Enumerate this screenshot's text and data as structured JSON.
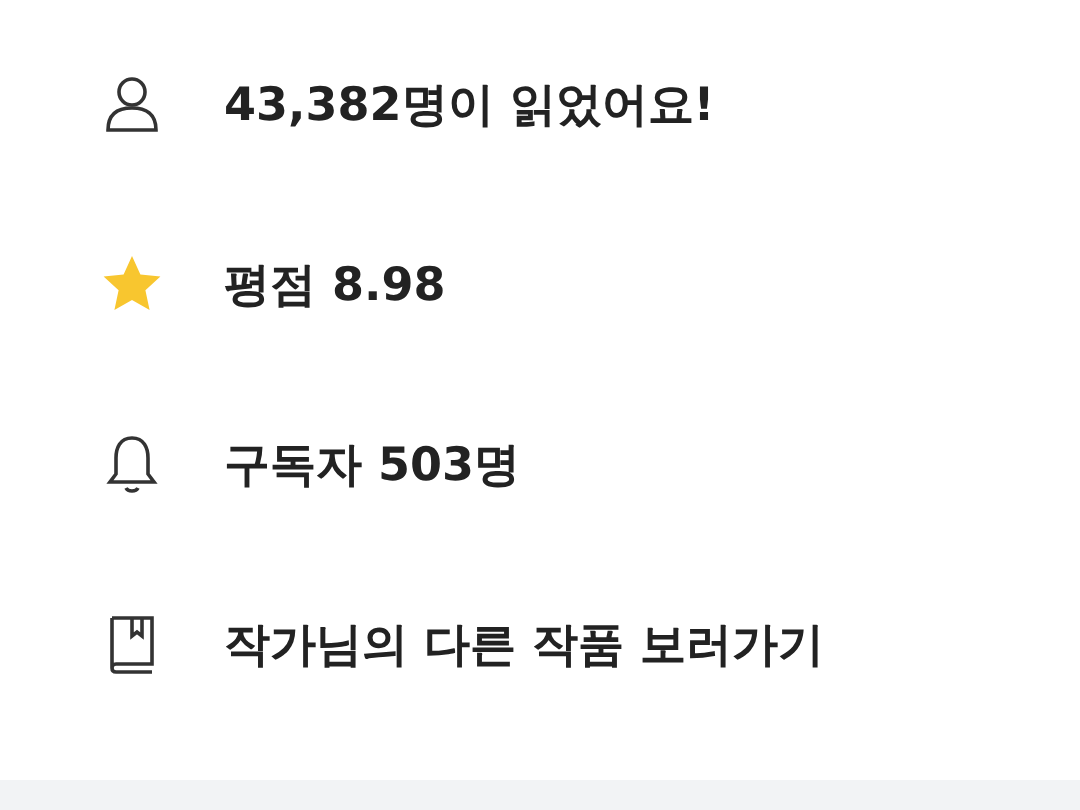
{
  "info_rows": [
    {
      "kind": "readers",
      "text": "43,382명이 읽었어요!"
    },
    {
      "kind": "rating",
      "text": "평점 8.98"
    },
    {
      "kind": "subscribers",
      "text": "구독자 503명"
    },
    {
      "kind": "other_works",
      "text": "작가님의 다른 작품 보러가기"
    }
  ]
}
